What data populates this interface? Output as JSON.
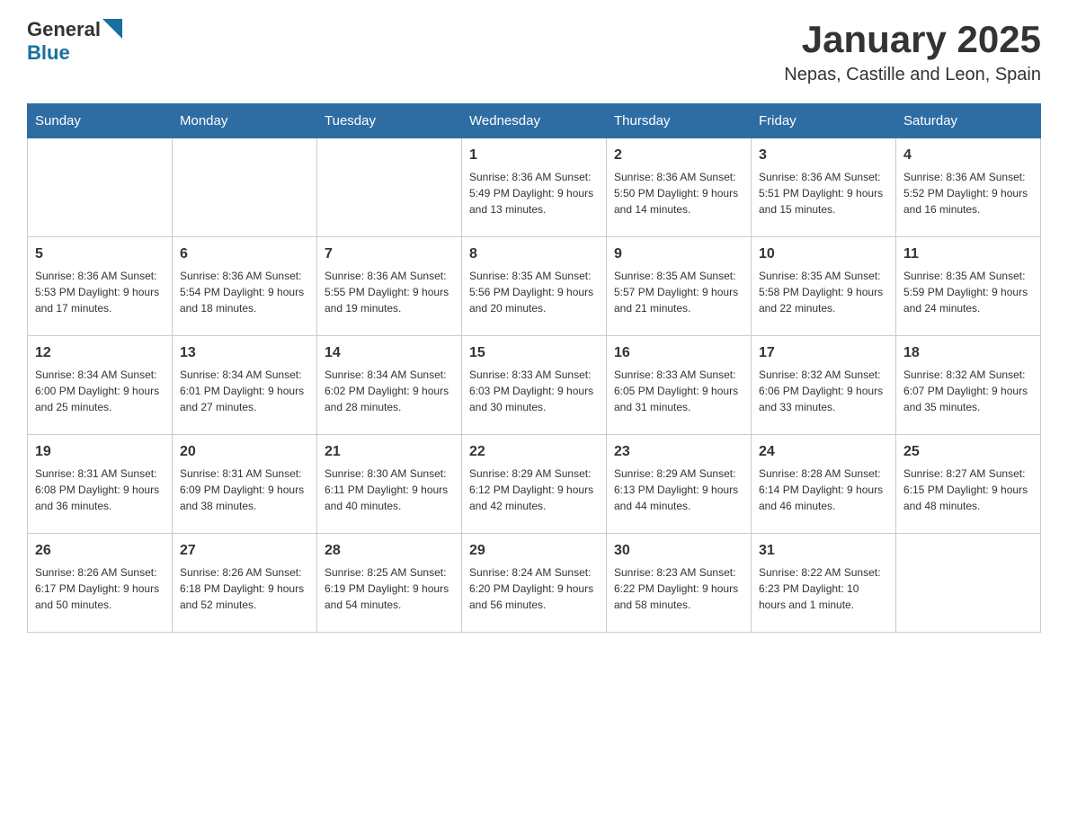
{
  "header": {
    "logo_general": "General",
    "logo_blue": "Blue",
    "title": "January 2025",
    "subtitle": "Nepas, Castille and Leon, Spain"
  },
  "weekdays": [
    "Sunday",
    "Monday",
    "Tuesday",
    "Wednesday",
    "Thursday",
    "Friday",
    "Saturday"
  ],
  "weeks": [
    [
      {
        "day": "",
        "info": ""
      },
      {
        "day": "",
        "info": ""
      },
      {
        "day": "",
        "info": ""
      },
      {
        "day": "1",
        "info": "Sunrise: 8:36 AM\nSunset: 5:49 PM\nDaylight: 9 hours\nand 13 minutes."
      },
      {
        "day": "2",
        "info": "Sunrise: 8:36 AM\nSunset: 5:50 PM\nDaylight: 9 hours\nand 14 minutes."
      },
      {
        "day": "3",
        "info": "Sunrise: 8:36 AM\nSunset: 5:51 PM\nDaylight: 9 hours\nand 15 minutes."
      },
      {
        "day": "4",
        "info": "Sunrise: 8:36 AM\nSunset: 5:52 PM\nDaylight: 9 hours\nand 16 minutes."
      }
    ],
    [
      {
        "day": "5",
        "info": "Sunrise: 8:36 AM\nSunset: 5:53 PM\nDaylight: 9 hours\nand 17 minutes."
      },
      {
        "day": "6",
        "info": "Sunrise: 8:36 AM\nSunset: 5:54 PM\nDaylight: 9 hours\nand 18 minutes."
      },
      {
        "day": "7",
        "info": "Sunrise: 8:36 AM\nSunset: 5:55 PM\nDaylight: 9 hours\nand 19 minutes."
      },
      {
        "day": "8",
        "info": "Sunrise: 8:35 AM\nSunset: 5:56 PM\nDaylight: 9 hours\nand 20 minutes."
      },
      {
        "day": "9",
        "info": "Sunrise: 8:35 AM\nSunset: 5:57 PM\nDaylight: 9 hours\nand 21 minutes."
      },
      {
        "day": "10",
        "info": "Sunrise: 8:35 AM\nSunset: 5:58 PM\nDaylight: 9 hours\nand 22 minutes."
      },
      {
        "day": "11",
        "info": "Sunrise: 8:35 AM\nSunset: 5:59 PM\nDaylight: 9 hours\nand 24 minutes."
      }
    ],
    [
      {
        "day": "12",
        "info": "Sunrise: 8:34 AM\nSunset: 6:00 PM\nDaylight: 9 hours\nand 25 minutes."
      },
      {
        "day": "13",
        "info": "Sunrise: 8:34 AM\nSunset: 6:01 PM\nDaylight: 9 hours\nand 27 minutes."
      },
      {
        "day": "14",
        "info": "Sunrise: 8:34 AM\nSunset: 6:02 PM\nDaylight: 9 hours\nand 28 minutes."
      },
      {
        "day": "15",
        "info": "Sunrise: 8:33 AM\nSunset: 6:03 PM\nDaylight: 9 hours\nand 30 minutes."
      },
      {
        "day": "16",
        "info": "Sunrise: 8:33 AM\nSunset: 6:05 PM\nDaylight: 9 hours\nand 31 minutes."
      },
      {
        "day": "17",
        "info": "Sunrise: 8:32 AM\nSunset: 6:06 PM\nDaylight: 9 hours\nand 33 minutes."
      },
      {
        "day": "18",
        "info": "Sunrise: 8:32 AM\nSunset: 6:07 PM\nDaylight: 9 hours\nand 35 minutes."
      }
    ],
    [
      {
        "day": "19",
        "info": "Sunrise: 8:31 AM\nSunset: 6:08 PM\nDaylight: 9 hours\nand 36 minutes."
      },
      {
        "day": "20",
        "info": "Sunrise: 8:31 AM\nSunset: 6:09 PM\nDaylight: 9 hours\nand 38 minutes."
      },
      {
        "day": "21",
        "info": "Sunrise: 8:30 AM\nSunset: 6:11 PM\nDaylight: 9 hours\nand 40 minutes."
      },
      {
        "day": "22",
        "info": "Sunrise: 8:29 AM\nSunset: 6:12 PM\nDaylight: 9 hours\nand 42 minutes."
      },
      {
        "day": "23",
        "info": "Sunrise: 8:29 AM\nSunset: 6:13 PM\nDaylight: 9 hours\nand 44 minutes."
      },
      {
        "day": "24",
        "info": "Sunrise: 8:28 AM\nSunset: 6:14 PM\nDaylight: 9 hours\nand 46 minutes."
      },
      {
        "day": "25",
        "info": "Sunrise: 8:27 AM\nSunset: 6:15 PM\nDaylight: 9 hours\nand 48 minutes."
      }
    ],
    [
      {
        "day": "26",
        "info": "Sunrise: 8:26 AM\nSunset: 6:17 PM\nDaylight: 9 hours\nand 50 minutes."
      },
      {
        "day": "27",
        "info": "Sunrise: 8:26 AM\nSunset: 6:18 PM\nDaylight: 9 hours\nand 52 minutes."
      },
      {
        "day": "28",
        "info": "Sunrise: 8:25 AM\nSunset: 6:19 PM\nDaylight: 9 hours\nand 54 minutes."
      },
      {
        "day": "29",
        "info": "Sunrise: 8:24 AM\nSunset: 6:20 PM\nDaylight: 9 hours\nand 56 minutes."
      },
      {
        "day": "30",
        "info": "Sunrise: 8:23 AM\nSunset: 6:22 PM\nDaylight: 9 hours\nand 58 minutes."
      },
      {
        "day": "31",
        "info": "Sunrise: 8:22 AM\nSunset: 6:23 PM\nDaylight: 10 hours\nand 1 minute."
      },
      {
        "day": "",
        "info": ""
      }
    ]
  ]
}
